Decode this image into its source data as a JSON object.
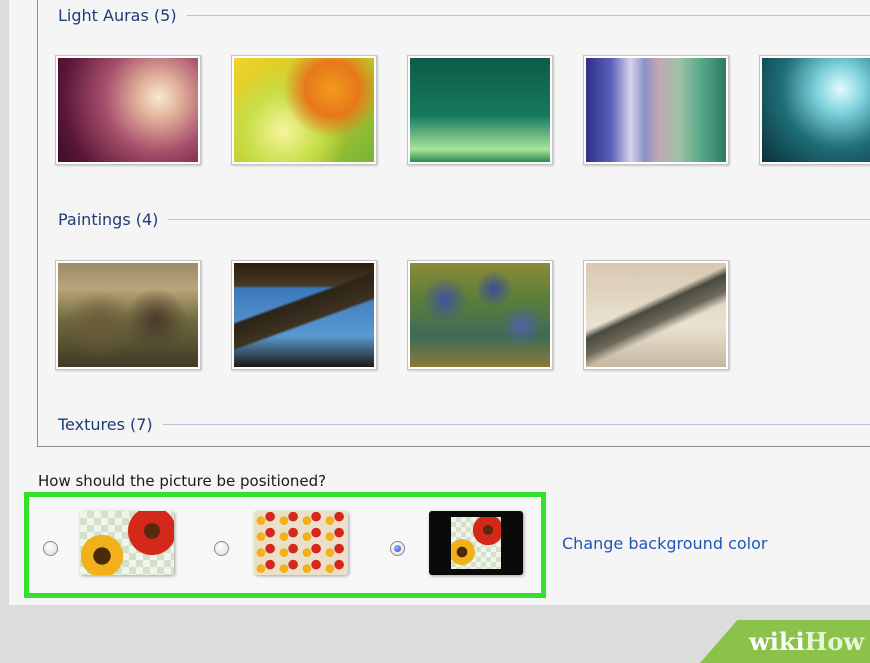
{
  "groups": [
    {
      "label": "Light Auras (5)"
    },
    {
      "label": "Paintings (4)"
    },
    {
      "label": "Textures (7)"
    }
  ],
  "prompt": "How should the picture be positioned?",
  "change_color_link": "Change background color",
  "selected_position": "center",
  "watermark": {
    "wiki": "wiki",
    "how": "How"
  },
  "colors": {
    "highlight": "#34e02c",
    "link": "#1f56b8",
    "header": "#1e3c78"
  }
}
